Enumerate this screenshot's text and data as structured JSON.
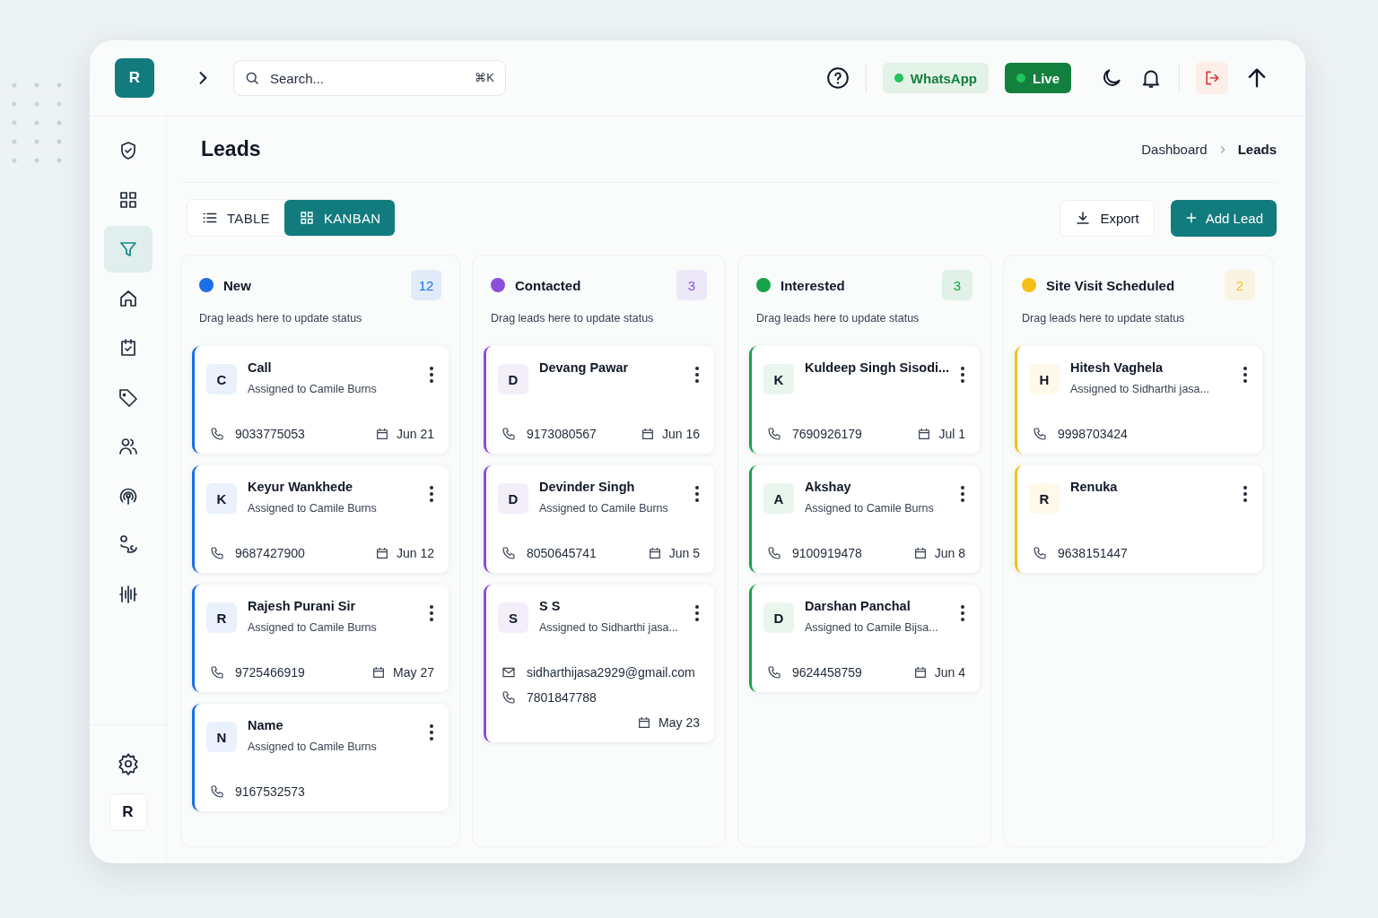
{
  "topbar": {
    "logo": "R",
    "search": {
      "placeholder": "Search...",
      "shortcut": "⌘K"
    },
    "whatsapp": "WhatsApp",
    "live": "Live"
  },
  "sidebar": {
    "items": [
      {
        "selected": false
      },
      {
        "selected": false
      },
      {
        "selected": true
      },
      {
        "selected": false
      },
      {
        "selected": false
      },
      {
        "selected": false
      },
      {
        "selected": false
      },
      {
        "selected": false
      },
      {
        "selected": false
      },
      {
        "selected": false
      }
    ],
    "avatar": "R"
  },
  "page": {
    "title": "Leads",
    "breadcrumbs": [
      "Dashboard",
      "Leads"
    ]
  },
  "view_tabs": [
    {
      "label": "TABLE",
      "selected": false
    },
    {
      "label": "KANBAN",
      "selected": true
    }
  ],
  "actions": {
    "export": "Export",
    "add": "Add Lead"
  },
  "columns": [
    {
      "title": "New",
      "color": "#1a6fe8",
      "count": "12",
      "hint": "Drag leads here to update status",
      "cards": [
        {
          "initial": "C",
          "name": "Call",
          "assigned": "Assigned to Camile Burns",
          "phone": "9033775053",
          "date": "Jun 21"
        },
        {
          "initial": "K",
          "name": "Keyur Wankhede",
          "assigned": "Assigned to Camile Burns",
          "phone": "9687427900",
          "date": "Jun 12"
        },
        {
          "initial": "R",
          "name": "Rajesh Purani Sir",
          "assigned": "Assigned to Camile Burns",
          "phone": "9725466919",
          "date": "May 27"
        },
        {
          "initial": "N",
          "name": "Name",
          "assigned": "Assigned to Camile Burns",
          "phone": "9167532573"
        }
      ]
    },
    {
      "title": "Contacted",
      "color": "#8b4fd8",
      "count": "3",
      "hint": "Drag leads here to update status",
      "cards": [
        {
          "initial": "D",
          "name": "Devang Pawar",
          "phone": "9173080567",
          "date": "Jun 16"
        },
        {
          "initial": "D",
          "name": "Devinder Singh",
          "assigned": "Assigned to Camile Burns",
          "phone": "8050645741",
          "date": "Jun 5"
        },
        {
          "initial": "S",
          "name": "S S",
          "assigned": "Assigned to Sidharthi jasa...",
          "email": "sidharthijasa2929@gmail.com",
          "phone": "7801847788",
          "date": "May 23"
        }
      ]
    },
    {
      "title": "Interested",
      "color": "#16a34a",
      "count": "3",
      "hint": "Drag leads here to update status",
      "cards": [
        {
          "initial": "K",
          "name": "Kuldeep Singh Sisodi...",
          "phone": "7690926179",
          "date": "Jul 1"
        },
        {
          "initial": "A",
          "name": "Akshay",
          "assigned": "Assigned to Camile Burns",
          "phone": "9100919478",
          "date": "Jun 8"
        },
        {
          "initial": "D",
          "name": "Darshan Panchal",
          "assigned": "Assigned to Camile Bijsa...",
          "phone": "9624458759",
          "date": "Jun 4"
        }
      ]
    },
    {
      "title": "Site Visit Scheduled",
      "color": "#f5bf1a",
      "count": "2",
      "hint": "Drag leads here to update status",
      "cards": [
        {
          "initial": "H",
          "name": "Hitesh Vaghela",
          "assigned": "Assigned to Sidharthi jasa...",
          "phone": "9998703424"
        },
        {
          "initial": "R",
          "name": "Renuka",
          "phone": "9638151447"
        }
      ]
    }
  ]
}
